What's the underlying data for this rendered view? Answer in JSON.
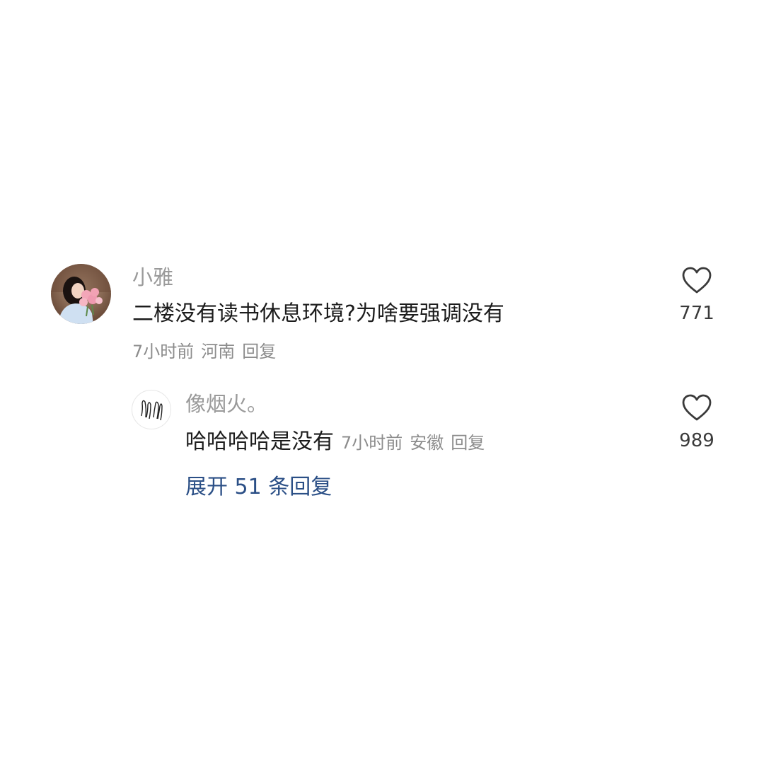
{
  "comment": {
    "username": "小雅",
    "text": "二楼没有读书休息环境?为啥要强调没有",
    "time": "7小时前",
    "location": "河南",
    "reply_label": "回复",
    "likes": "771",
    "like_icon": "heart-outline-icon"
  },
  "reply": {
    "username": "像烟火。",
    "text": "哈哈哈哈是没有",
    "time": "7小时前",
    "location": "安徽",
    "reply_label": "回复",
    "likes": "989",
    "like_icon": "heart-outline-icon"
  },
  "expand_label": "展开 51 条回复",
  "colors": {
    "username": "#9a9a9a",
    "text": "#1c1c1c",
    "meta": "#8c8c8c",
    "link": "#2b4f86"
  }
}
